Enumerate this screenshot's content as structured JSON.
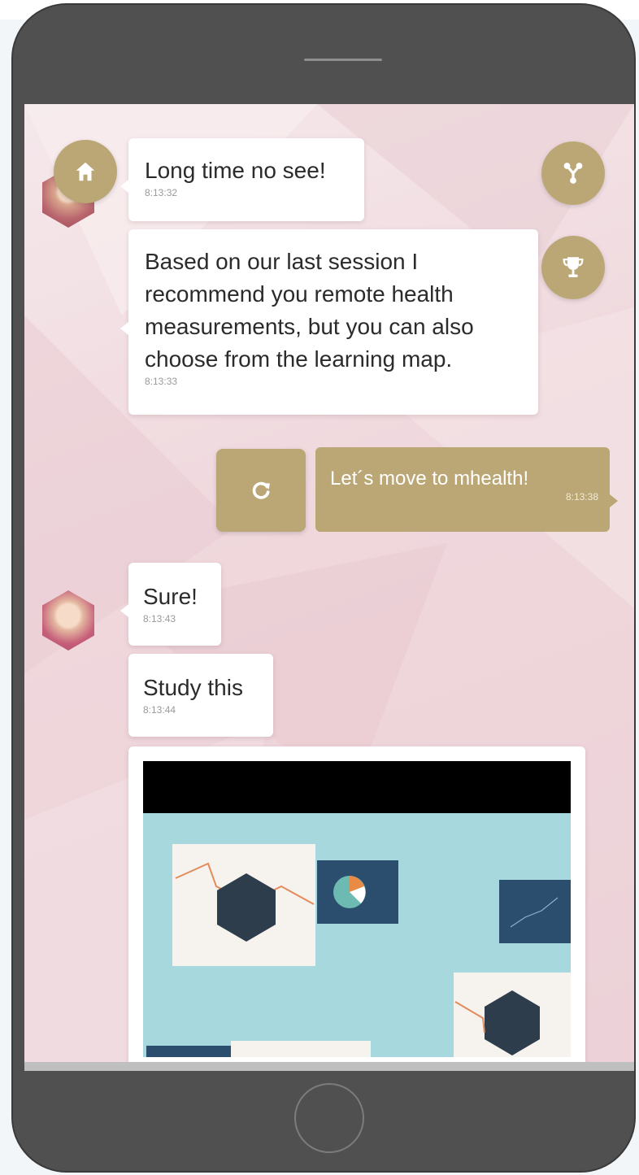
{
  "chat": {
    "messages": [
      {
        "text": "Long time no see!",
        "time": "8:13:32"
      },
      {
        "text": "Based on our last session I recommend you remote health measurements, but you can also choose from the learning map.",
        "time": "8:13:33"
      },
      {
        "text": "Let´s move to mhealth!",
        "time": "8:13:38"
      },
      {
        "text": "Sure!",
        "time": "8:13:43"
      },
      {
        "text": "Study this",
        "time": "8:13:44"
      }
    ]
  },
  "icons": {
    "home": "home-icon",
    "map": "learning-map-icon",
    "trophy": "trophy-icon",
    "refresh": "refresh-icon"
  },
  "colors": {
    "accent": "#bba776",
    "bubble": "#ffffff",
    "background": "#efd7dc",
    "video_art": "#a7d8dd"
  }
}
